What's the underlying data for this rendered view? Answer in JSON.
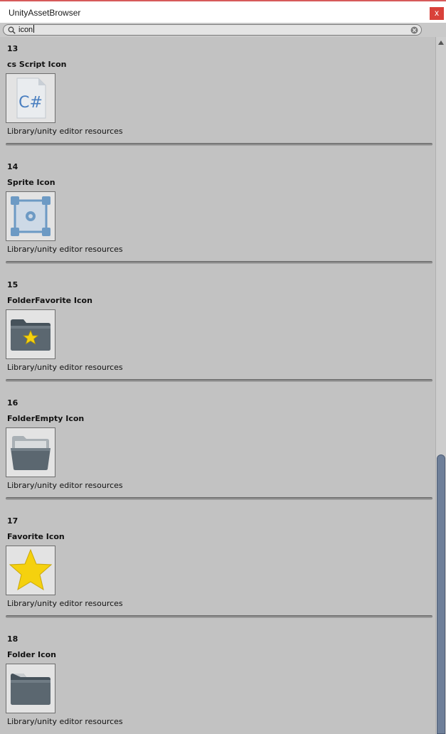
{
  "window": {
    "title": "UnityAssetBrowser",
    "close_label": "x"
  },
  "search": {
    "value": "icon"
  },
  "items": [
    {
      "index": "13",
      "name": "cs Script Icon",
      "path": "Library/unity editor resources",
      "icon": "cs-script-icon"
    },
    {
      "index": "14",
      "name": "Sprite Icon",
      "path": "Library/unity editor resources",
      "icon": "sprite-icon"
    },
    {
      "index": "15",
      "name": "FolderFavorite Icon",
      "path": "Library/unity editor resources",
      "icon": "folder-favorite-icon"
    },
    {
      "index": "16",
      "name": "FolderEmpty Icon",
      "path": "Library/unity editor resources",
      "icon": "folder-empty-icon"
    },
    {
      "index": "17",
      "name": "Favorite Icon",
      "path": "Library/unity editor resources",
      "icon": "favorite-icon"
    },
    {
      "index": "18",
      "name": "Folder Icon",
      "path": "Library/unity editor resources",
      "icon": "folder-icon"
    }
  ],
  "colors": {
    "background": "#c2c2c2",
    "scroll_thumb": "#6e7f99",
    "close_button": "#d9413a",
    "star": "#f5d10e",
    "folder": "#5b6770",
    "csharp": "#4a7fc0"
  }
}
